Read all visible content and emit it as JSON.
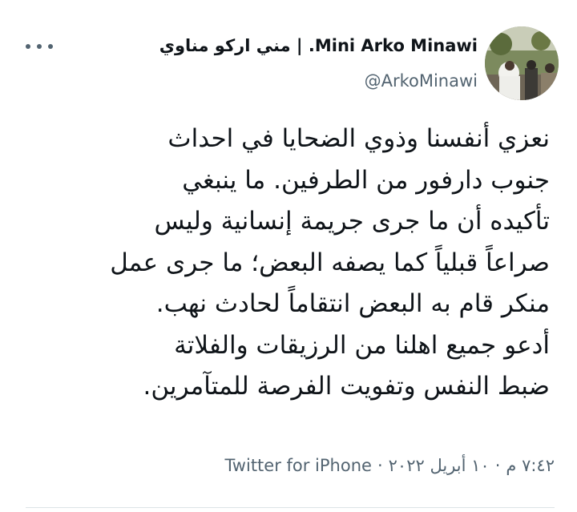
{
  "author": {
    "display_name": "مني اركو مناوي | .Mini Arko Minawi",
    "handle": "@ArkoMinawi",
    "avatar_alt_icon": "profile-photo"
  },
  "menu": {
    "more_icon": "more-horizontal-icon"
  },
  "tweet": {
    "lines": [
      "نعزي أنفسنا وذوي الضحايا في احداث",
      "جنوب دارفور من الطرفين. ما ينبغي",
      "تأكيده أن ما جرى جريمة إنسانية وليس",
      "صراعاً قبلياً كما يصفه البعض؛ ما جرى عمل",
      "منكر قام به البعض انتقاماً لحادث نهب.",
      "أدعو جميع اهلنا من الرزيقات والفلاتة",
      "ضبط النفس وتفويت الفرصة للمتآمرين."
    ]
  },
  "meta": {
    "time": "٧:٤٢ م",
    "date": "١٠ أبريل ٢٠٢٢",
    "separator": "·",
    "source": "Twitter for iPhone"
  },
  "colors": {
    "text": "#0f1419",
    "secondary": "#536471",
    "divider": "#dde3e7"
  }
}
